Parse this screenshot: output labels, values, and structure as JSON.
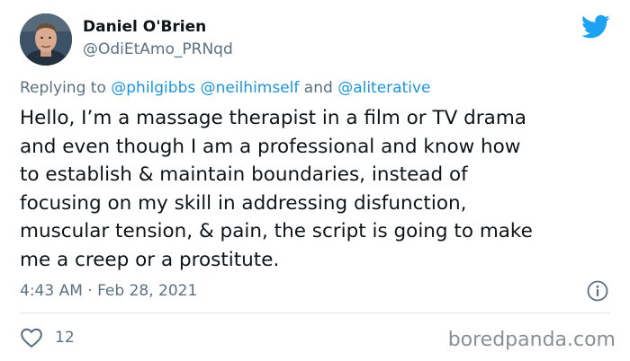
{
  "author": {
    "display_name": "Daniel O'Brien",
    "handle": "@OdiEtAmo_PRNqd"
  },
  "reply": {
    "prefix": "Replying to",
    "mentions": [
      "@philgibbs",
      "@neilhimself",
      "@aliterative"
    ],
    "joiner": "and"
  },
  "tweet": {
    "lines": [
      "Hello, I’m a massage therapist in a film or TV drama",
      "and even though I am a professional and know how",
      "to establish & maintain boundaries, instead of",
      "focusing on my skill in addressing disfunction,",
      "muscular tension, & pain, the script is going to make",
      "me a creep or a prostitute."
    ],
    "timestamp": "4:43 AM · Feb 28, 2021"
  },
  "engagement": {
    "like_count": "12"
  },
  "watermark": "boredpanda.com",
  "icons": [
    "twitter-bird-icon",
    "info-icon",
    "heart-icon"
  ],
  "colors": {
    "twitter_blue": "#1da1f2",
    "mention_blue": "#1b95e0",
    "secondary_text": "#5b7083",
    "divider": "#e1e8ed"
  }
}
